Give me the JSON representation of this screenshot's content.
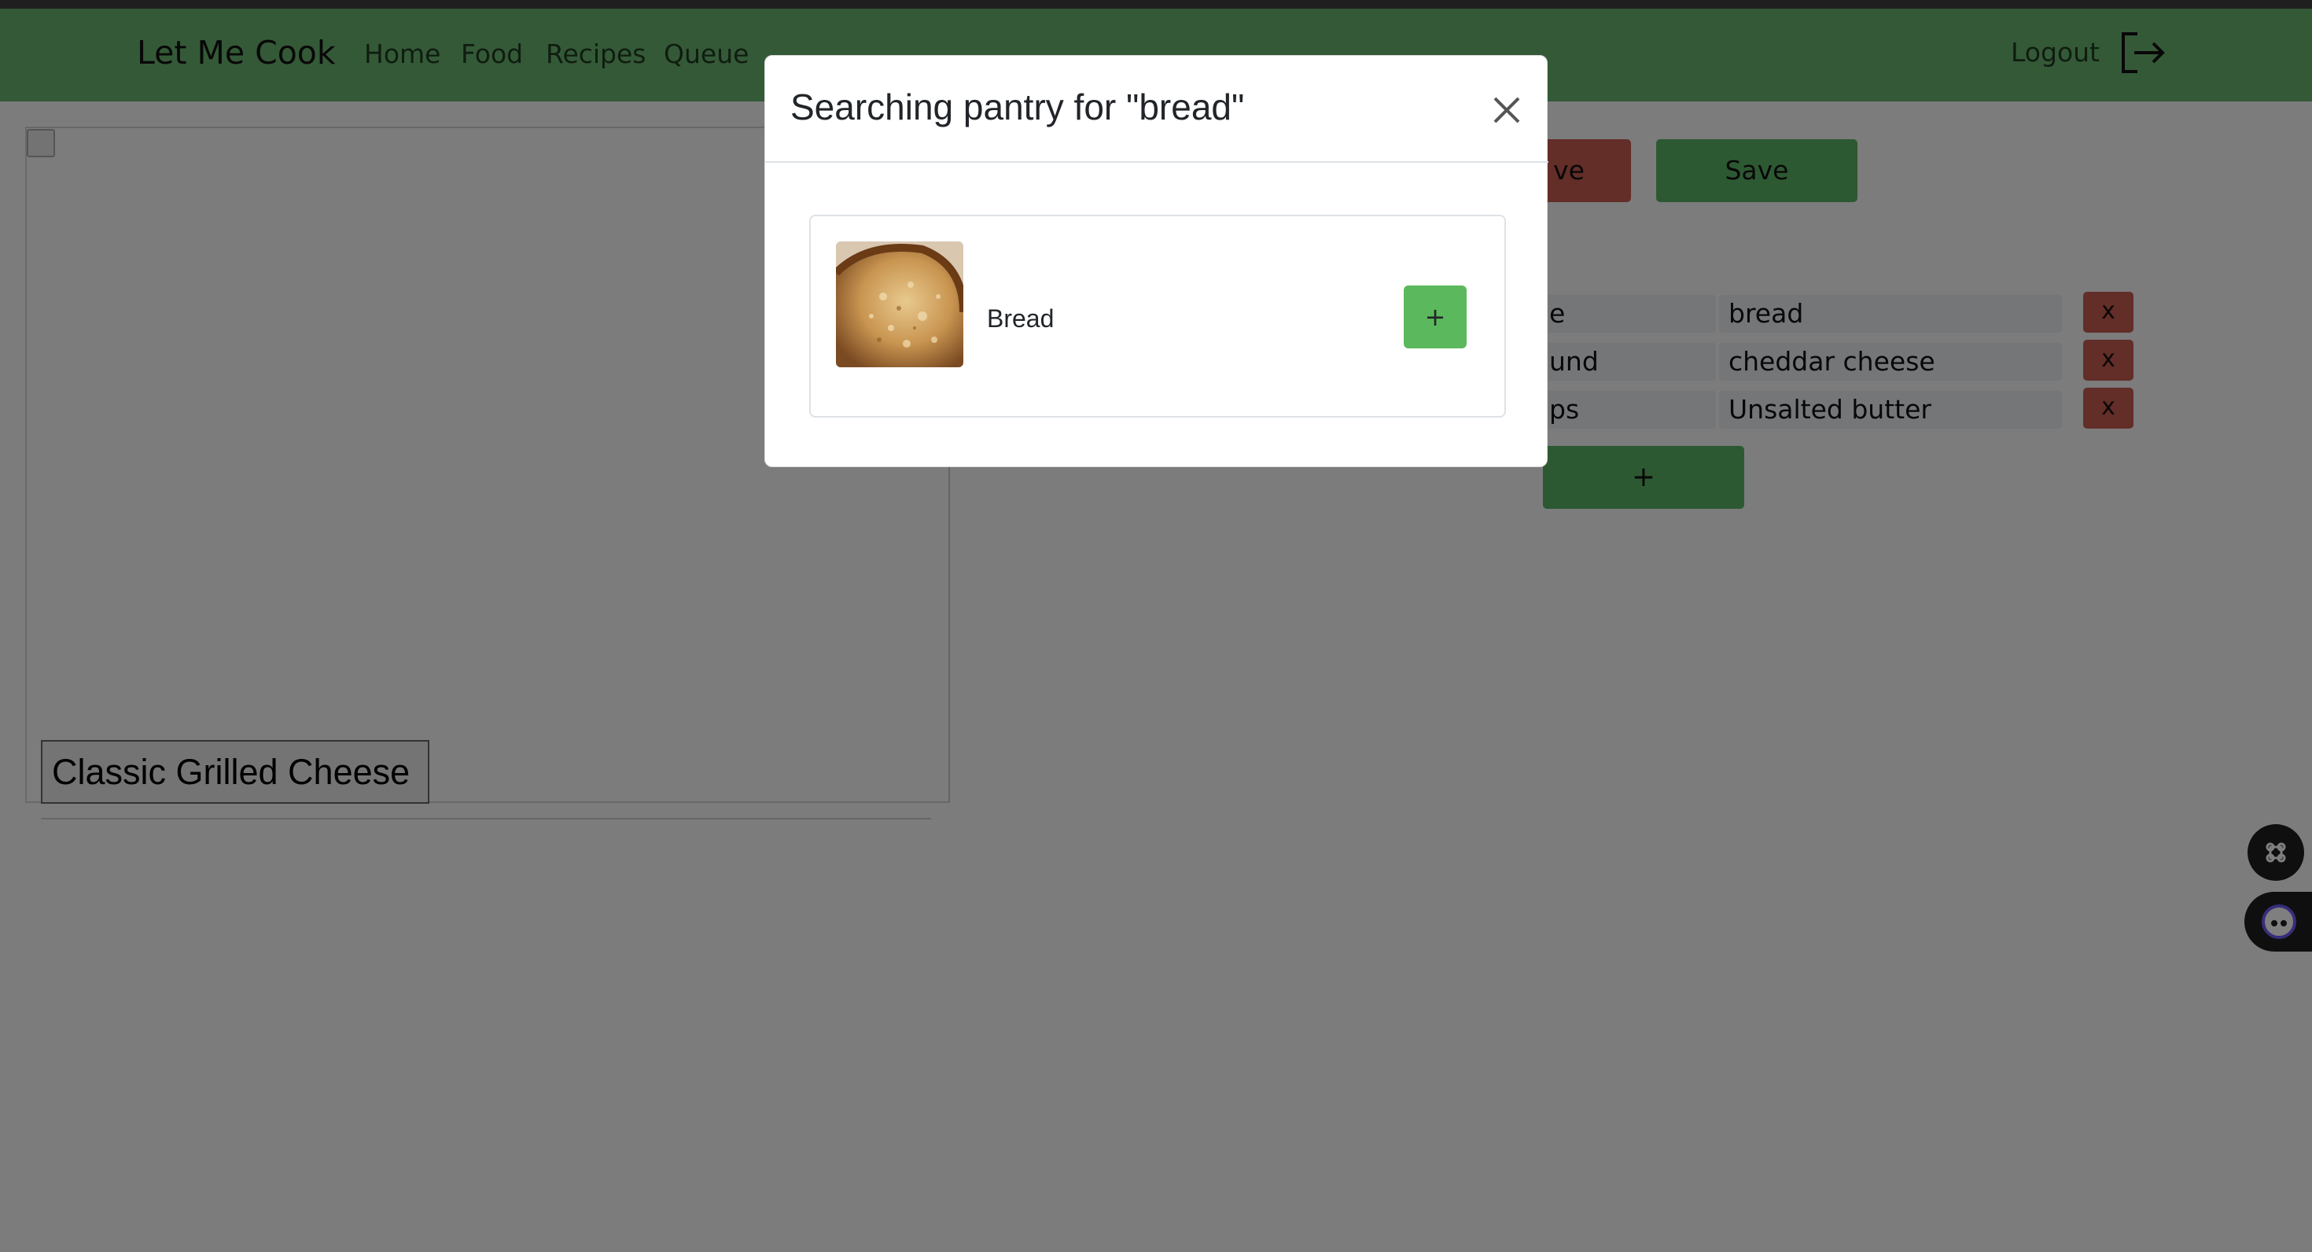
{
  "navbar": {
    "brand": "Let Me Cook",
    "links": [
      "Home",
      "Food",
      "Recipes",
      "Queue"
    ],
    "logout_label": "Logout",
    "icons": {
      "logout": "logout-icon"
    }
  },
  "recipe": {
    "title": "Classic Grilled Cheese"
  },
  "actions": {
    "remove_label": "ve",
    "save_label": "Save",
    "add_ingredient_label": "+"
  },
  "ingredients": [
    {
      "amount": "e",
      "name": "bread",
      "delete_label": "x"
    },
    {
      "amount": "und",
      "name": "cheddar cheese",
      "delete_label": "x"
    },
    {
      "amount": "ps",
      "name": "Unsalted butter",
      "delete_label": "x"
    }
  ],
  "modal": {
    "title": "Searching pantry for \"bread\"",
    "close_icon": "close-icon",
    "results": [
      {
        "name": "Bread",
        "add_label": "+",
        "thumbnail_icon": "bread-photo"
      }
    ]
  },
  "floating": {
    "shortcut_icon": "command-icon",
    "assistant_icon": "assistant-face-icon"
  },
  "colors": {
    "navbar": "#68b26f",
    "primary_green": "#5bb265",
    "danger_red": "#c75b51",
    "modal_add_green": "#5cb85c",
    "backdrop": "rgba(0,0,0,0.5)"
  }
}
